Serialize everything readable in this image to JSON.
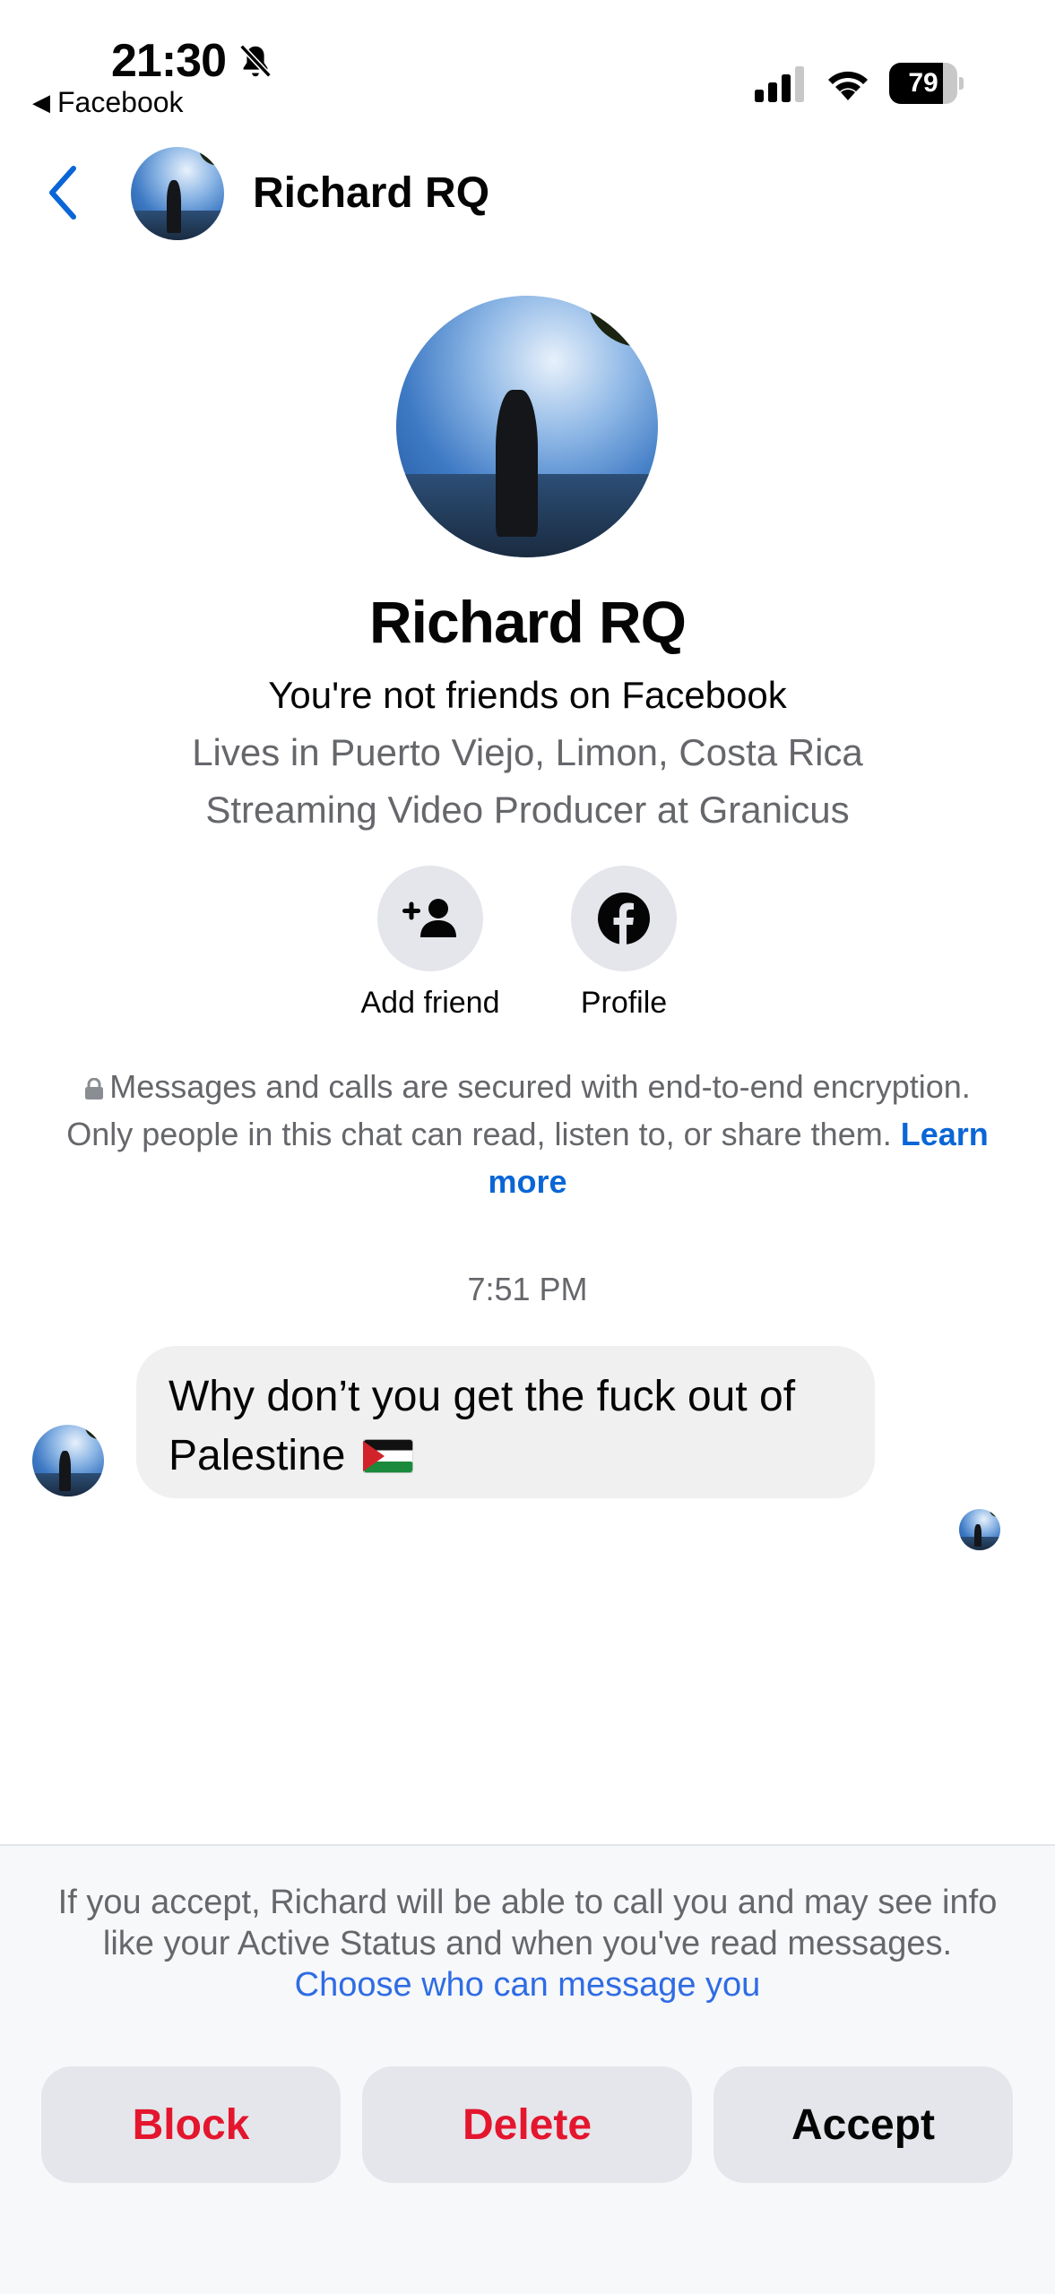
{
  "status_bar": {
    "time": "21:30",
    "back_app": "Facebook",
    "battery": "79",
    "battery_level": 0.79
  },
  "header": {
    "name": "Richard RQ"
  },
  "profile": {
    "name": "Richard RQ",
    "relationship": "You're not friends on Facebook",
    "lives_in": "Lives in Puerto Viejo, Limon, Costa Rica",
    "work": "Streaming Video Producer at Granicus",
    "actions": {
      "add_friend": "Add friend",
      "profile": "Profile"
    }
  },
  "encryption": {
    "text": "Messages and calls are secured with end-to-end encryption. Only people in this chat can read, listen to, or share them.",
    "link": "Learn more"
  },
  "conversation": {
    "timestamp": "7:51 PM",
    "messages": [
      {
        "text": "Why don’t you get the fuck out of Palestine"
      }
    ]
  },
  "request": {
    "info": "If you accept, Richard will be able to call you and may see info like your Active Status and when you've read messages.",
    "link": "Choose who can message you",
    "buttons": {
      "block": "Block",
      "delete": "Delete",
      "accept": "Accept"
    }
  },
  "colors": {
    "link_blue": "#0a66d6",
    "danger_red": "#e4162e",
    "button_gray": "#e4e6eb",
    "secondary_text": "#65676b"
  },
  "icons": [
    "bell-slash-icon",
    "signal-icon",
    "wifi-icon",
    "battery-icon",
    "back-chevron-icon",
    "add-friend-icon",
    "facebook-icon",
    "lock-icon",
    "palestine-flag-icon"
  ]
}
